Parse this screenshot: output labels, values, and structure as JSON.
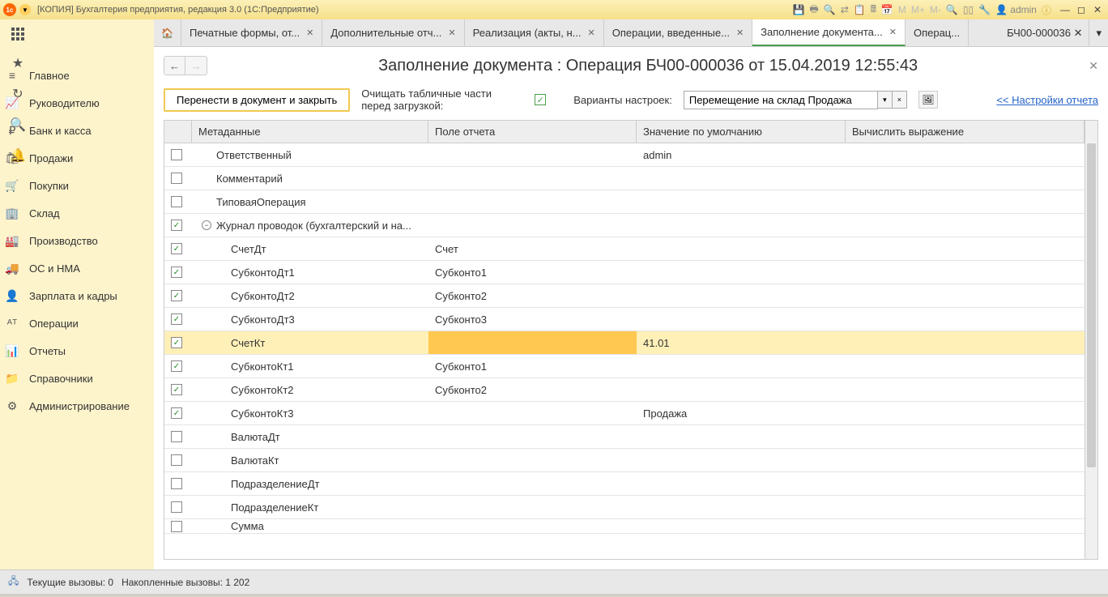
{
  "titlebar": {
    "title": "[КОПИЯ] Бухгалтерия предприятия, редакция 3.0  (1С:Предприятие)",
    "user": "admin",
    "m_labels": [
      "M",
      "M+",
      "M-"
    ]
  },
  "left_icons": [
    "⠿",
    "★",
    "↻",
    "🔍",
    "🔔"
  ],
  "nav": [
    {
      "icon": "≡",
      "label": "Главное"
    },
    {
      "icon": "📈",
      "label": "Руководителю"
    },
    {
      "icon": "₽",
      "label": "Банк и касса"
    },
    {
      "icon": "🛍",
      "label": "Продажи"
    },
    {
      "icon": "🛒",
      "label": "Покупки"
    },
    {
      "icon": "🏢",
      "label": "Склад"
    },
    {
      "icon": "🏭",
      "label": "Производство"
    },
    {
      "icon": "🚚",
      "label": "ОС и НМА"
    },
    {
      "icon": "👤",
      "label": "Зарплата и кадры"
    },
    {
      "icon": "ᴬᵀ",
      "label": "Операции"
    },
    {
      "icon": "📊",
      "label": "Отчеты"
    },
    {
      "icon": "📁",
      "label": "Справочники"
    },
    {
      "icon": "⚙",
      "label": "Администрирование"
    }
  ],
  "tabs": [
    {
      "label": "Печатные формы, от...",
      "active": false
    },
    {
      "label": "Дополнительные отч...",
      "active": false
    },
    {
      "label": "Реализация (акты, н...",
      "active": false
    },
    {
      "label": "Операции, введенные...",
      "active": false
    },
    {
      "label": "Заполнение документа...",
      "active": true
    },
    {
      "label": "Операц...",
      "active": false,
      "noclose": true
    }
  ],
  "tab_last": "БЧ00-000036",
  "doc": {
    "title": "Заполнение документа : Операция БЧ00-000036 от 15.04.2019 12:55:43"
  },
  "toolbar": {
    "transfer_button": "Перенести в документ и закрыть",
    "clear_label": "Очищать табличные части перед загрузкой:",
    "variants_label": "Варианты настроек:",
    "variants_value": "Перемещение на склад Продажа",
    "report_link": "<< Настройки отчета"
  },
  "table": {
    "headers": {
      "meta": "Метаданные",
      "field": "Поле  отчета",
      "default": "Значение по умолчанию",
      "expr": "Вычислить выражение"
    },
    "rows": [
      {
        "checked": false,
        "indent": 1,
        "meta": "Ответственный",
        "field": "",
        "default": "admin",
        "expr": ""
      },
      {
        "checked": false,
        "indent": 1,
        "meta": "Комментарий",
        "field": "",
        "default": "",
        "expr": ""
      },
      {
        "checked": false,
        "indent": 1,
        "meta": "ТиповаяОперация",
        "field": "",
        "default": "",
        "expr": ""
      },
      {
        "checked": true,
        "indent": 1,
        "tree": true,
        "meta": "Журнал проводок (бухгалтерский и на...",
        "field": "",
        "default": "",
        "expr": ""
      },
      {
        "checked": true,
        "indent": 2,
        "meta": "СчетДт",
        "field": "Счет",
        "default": "",
        "expr": ""
      },
      {
        "checked": true,
        "indent": 2,
        "meta": "СубконтоДт1",
        "field": "Субконто1",
        "default": "",
        "expr": ""
      },
      {
        "checked": true,
        "indent": 2,
        "meta": "СубконтоДт2",
        "field": "Субконто2",
        "default": "",
        "expr": ""
      },
      {
        "checked": true,
        "indent": 2,
        "meta": "СубконтоДт3",
        "field": "Субконто3",
        "default": "",
        "expr": ""
      },
      {
        "checked": true,
        "indent": 2,
        "selected": true,
        "meta": "СчетКт",
        "field": "",
        "default": "41.01",
        "expr": ""
      },
      {
        "checked": true,
        "indent": 2,
        "meta": "СубконтоКт1",
        "field": "Субконто1",
        "default": "",
        "expr": ""
      },
      {
        "checked": true,
        "indent": 2,
        "meta": "СубконтоКт2",
        "field": "Субконто2",
        "default": "",
        "expr": ""
      },
      {
        "checked": true,
        "indent": 2,
        "meta": "СубконтоКт3",
        "field": "",
        "default": "Продажа",
        "expr": ""
      },
      {
        "checked": false,
        "indent": 2,
        "meta": "ВалютаДт",
        "field": "",
        "default": "",
        "expr": ""
      },
      {
        "checked": false,
        "indent": 2,
        "meta": "ВалютаКт",
        "field": "",
        "default": "",
        "expr": ""
      },
      {
        "checked": false,
        "indent": 2,
        "meta": "ПодразделениеДт",
        "field": "",
        "default": "",
        "expr": ""
      },
      {
        "checked": false,
        "indent": 2,
        "meta": "ПодразделениеКт",
        "field": "",
        "default": "",
        "expr": ""
      },
      {
        "checked": false,
        "indent": 2,
        "meta": "Сумма",
        "field": "",
        "default": "",
        "expr": "",
        "partial": true
      }
    ]
  },
  "statusbar": {
    "current": "Текущие вызовы: 0",
    "accumulated": "Накопленные вызовы: 1 202"
  }
}
